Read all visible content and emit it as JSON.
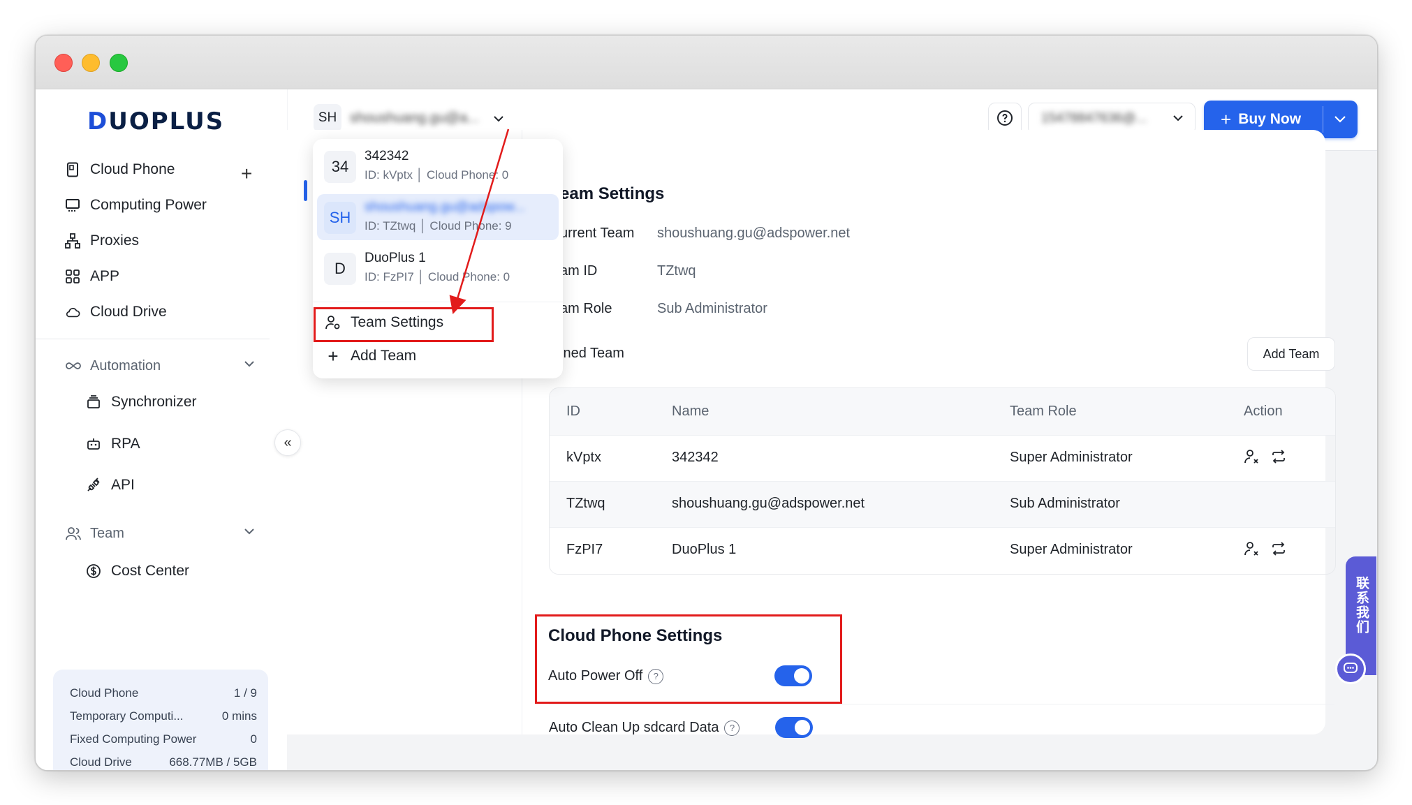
{
  "brand": {
    "logo": "DUOPLUS"
  },
  "sidebar": {
    "items": [
      {
        "label": "Cloud Phone",
        "icon": "phone-icon"
      },
      {
        "label": "Computing Power",
        "icon": "monitor-icon"
      },
      {
        "label": "Proxies",
        "icon": "network-icon"
      },
      {
        "label": "APP",
        "icon": "grid-icon"
      },
      {
        "label": "Cloud Drive",
        "icon": "cloud-icon"
      }
    ],
    "automation": {
      "label": "Automation",
      "items": [
        {
          "label": "Synchronizer"
        },
        {
          "label": "RPA"
        },
        {
          "label": "API"
        }
      ]
    },
    "team": {
      "label": "Team",
      "items": [
        {
          "label": "Cost Center"
        }
      ]
    },
    "stats": [
      {
        "label": "Cloud Phone",
        "value": "1 / 9"
      },
      {
        "label": "Temporary Computi...",
        "value": "0 mins"
      },
      {
        "label": "Fixed Computing Power",
        "value": "0"
      },
      {
        "label": "Cloud Drive",
        "value": "668.77MB / 5GB"
      }
    ]
  },
  "header": {
    "team_initials": "SH",
    "team_name": "shoushuang.gu@a...",
    "account": "15478847636@...",
    "buy_label": "Buy Now"
  },
  "dropdown": {
    "teams": [
      {
        "initials": "34",
        "name": "342342",
        "meta": "ID: kVptx │ Cloud Phone: 0"
      },
      {
        "initials": "SH",
        "name": "shoushuang.gu@adspow...",
        "meta": "ID: TZtwq │ Cloud Phone: 9"
      },
      {
        "initials": "D",
        "name": "DuoPlus 1",
        "meta": "ID: FzPI7 │ Cloud Phone: 0"
      }
    ],
    "team_settings_label": "Team Settings",
    "add_team_label": "Add Team"
  },
  "team_settings": {
    "title": "eam Settings",
    "current_team_label": "urrent Team",
    "current_team_value": "shoushuang.gu@adspower.net",
    "team_id_label": "am ID",
    "team_id_value": "TZtwq",
    "team_role_label": "am Role",
    "team_role_value": "Sub Administrator",
    "joined_team_label": "ined Team",
    "add_team_button": "Add Team"
  },
  "table": {
    "headers": [
      "ID",
      "Name",
      "Team Role",
      "Action"
    ],
    "rows": [
      {
        "id": "kVptx",
        "name": "342342",
        "role": "Super Administrator",
        "actions": true
      },
      {
        "id": "TZtwq",
        "name": "shoushuang.gu@adspower.net",
        "role": "Sub Administrator",
        "actions": false
      },
      {
        "id": "FzPI7",
        "name": "DuoPlus 1",
        "role": "Super Administrator",
        "actions": true
      }
    ]
  },
  "cloud_phone_settings": {
    "title": "Cloud Phone Settings",
    "auto_power_off_label": "Auto Power Off",
    "auto_power_off": true,
    "auto_clean_label": "Auto Clean Up sdcard Data",
    "auto_clean": true
  },
  "contact": {
    "label": "联系我们"
  },
  "colors": {
    "accent": "#2563eb",
    "highlight_box": "#e21b1b",
    "contact": "#5b5bd6"
  }
}
